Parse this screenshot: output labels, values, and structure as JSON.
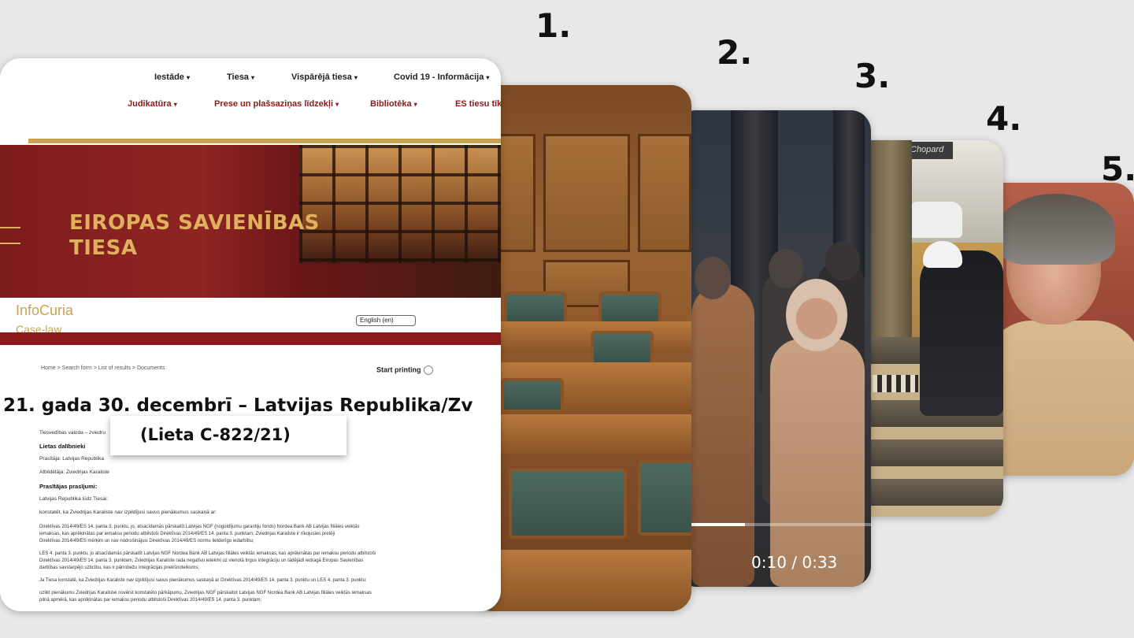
{
  "step_numbers": [
    "1.",
    "2.",
    "3.",
    "4.",
    "5."
  ],
  "card1": {
    "nav_top": [
      {
        "label": "Iestāde"
      },
      {
        "label": "Tiesa"
      },
      {
        "label": "Vispārējā tiesa"
      },
      {
        "label": "Covid 19 - Informācija"
      }
    ],
    "nav_bottom": [
      {
        "label": "Judikatūra"
      },
      {
        "label": "Prese un plašsaziņas līdzekļi"
      },
      {
        "label": "Bibliotēka"
      },
      {
        "label": "ES tiesu tīk"
      }
    ],
    "banner_title_line1": "EIROPAS SAVIENĪBAS",
    "banner_title_line2": "TIESA",
    "infocuria": "InfoCuria",
    "caselaw": "Case-law",
    "language": "English (en)",
    "breadcrumb": "Home > Search form > List of results > Documents",
    "start_printing": "Start printing",
    "heading": "21. gada 30. decembrī – Latvijas Republika/Zv",
    "case_number": "(Lieta C-822/21)",
    "doc_lines": [
      "Tiesvedības valoda – zviedru",
      "Lietas dalībnieki",
      "Prasītāja: Latvijas Republika",
      "Atbildētāja: Zviedrijas Karaliste",
      "Prasītājas prasījumi:",
      "Latvijas Republika lūdz Tiesai:",
      "konstatēt, ka Zviedrijas Karaliste nav izpildījusi savus pienākumus saskaņā ar:",
      "Direktīvas 2014/49/ES 14. panta 3. punktu, jo, atsacīdamās pārskaitīt Latvijas NGF (noguldījumu garantiju fonds) Nordea Bank AB Latvijas filiāles veiktās",
      "iemaksas, kas aprēķinātas par iemaksu periodu atbilstoši Direktīvas 2014/49/ES 14. panta 3. punktam, Zviedrijas Karaliste ir rīkojusies pretēji",
      "Direktīvas 2014/49/ES mērķim un nav nodrošinājusi Direktīvas 2014/49/ES normu lietderīgo iedarbību;",
      "LES 4. panta 3. punktu, jo atsacīdamās pārskaitīt Latvijas NGF Nordea Bank AB Latvijas filiāles veiktās iemaksas, kas aprēķinātas par iemaksu periodu atbilstoši",
      "Direktīvas 2014/49/ES 14. panta 3. punktam, Zviedrijas Karaliste rada negatīvu ietekmi uz vienotā tirgus integrāciju un tādējādi iedragā Eiropas Savienības",
      "darbības savstarpējo uzticību, kas ir pārrobežu integrācijas priekšnoteikums;",
      "Ja Tiesa konstatē, ka Zviedrijas Karaliste nav izpildījusi savus pienākumus saskaņā ar Direktīvas 2014/49/ES 14. panta 3. punktu un LES 4. panta 3. punktu:",
      "uzlikt pienākumu Zviedrijas Karalistei novērst konstatēto pārkāpumu, Zviedrijas NGF pārskaitot Latvijas NGF Nordea Bank AB Latvijas filiāles veiktās iemaksas",
      "pilnā apmērā, kas aprēķinātas par iemaksu periodu atbilstoši Direktīvas 2014/49/ES 14. panta 3. punktam;"
    ]
  },
  "card3": {
    "time_display": "0:10 / 0:33",
    "progress": 0.3
  },
  "card4": {
    "shop_sign": "Chopard"
  },
  "colors": {
    "background": "#e8e8e8",
    "banner_red": "#8b1a1a",
    "banner_gold": "#e0b15d"
  }
}
